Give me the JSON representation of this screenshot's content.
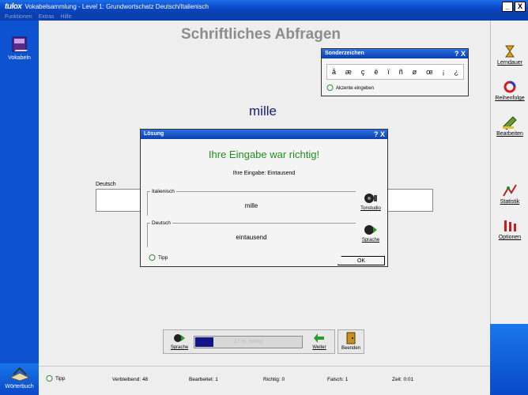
{
  "titlebar": {
    "logo": "tulox",
    "title": "Vokabelsammlung - Level 1: Grundwortschatz Deutsch/Italienisch",
    "minimize": "_",
    "close": "X"
  },
  "menubar": [
    "Funktionen",
    "Extras",
    "Hilfe"
  ],
  "left_sidebar": {
    "vokabeln": "Vokabeln",
    "woerterbuch": "Wörterbuch"
  },
  "right_sidebar": [
    {
      "label": "Lerndauer"
    },
    {
      "label": "Reihenfolge"
    },
    {
      "label": "Bearbeiten"
    },
    {
      "label": "Statistik"
    },
    {
      "label": "Optionen"
    }
  ],
  "main": {
    "heading": "Schriftliches Abfragen",
    "word": "mille",
    "deutsch_label": "Deutsch"
  },
  "sonderzeichen": {
    "title": "Sonderzeichen",
    "title_buttons": "? X",
    "chars": [
      "å",
      "æ",
      "ç",
      "ë",
      "ï",
      "ñ",
      "ø",
      "œ",
      "¡",
      "¿"
    ],
    "hint": "Akzente eingeben"
  },
  "loesung": {
    "title": "Lösung",
    "title_buttons": "? X",
    "result": "Ihre Eingabe war richtig!",
    "your_input": "Ihre Eingabe: Eintausend",
    "italienisch_label": "Italienisch",
    "italienisch_value": "mille",
    "deutsch_label": "Deutsch",
    "deutsch_value": "eintausend",
    "tonstudio": "Tonstudio",
    "sprache": "Sprache",
    "tipp": "Tipp",
    "ok": "OK"
  },
  "bottom_tools": {
    "sprache": "Sprache",
    "progress_text": "17 % richtig",
    "progress_fraction": 0.17,
    "weiter": "Weiter",
    "beenden": "Beenden"
  },
  "statusbar": {
    "tipp": "Tipp",
    "verbleibend": "Verbleibend: 48",
    "bearbeitet": "Bearbeitet: 1",
    "richtig": "Richtig: 0",
    "falsch": "Falsch: 1",
    "zeit": "Zeit: 0:01"
  },
  "colors": {
    "titlebar_blue": "#0a48c9",
    "heading_gray": "#8c8c8c",
    "word_navy": "#1a1a7a",
    "success_green": "#1f8f1f",
    "progress_fill": "#10158a"
  }
}
